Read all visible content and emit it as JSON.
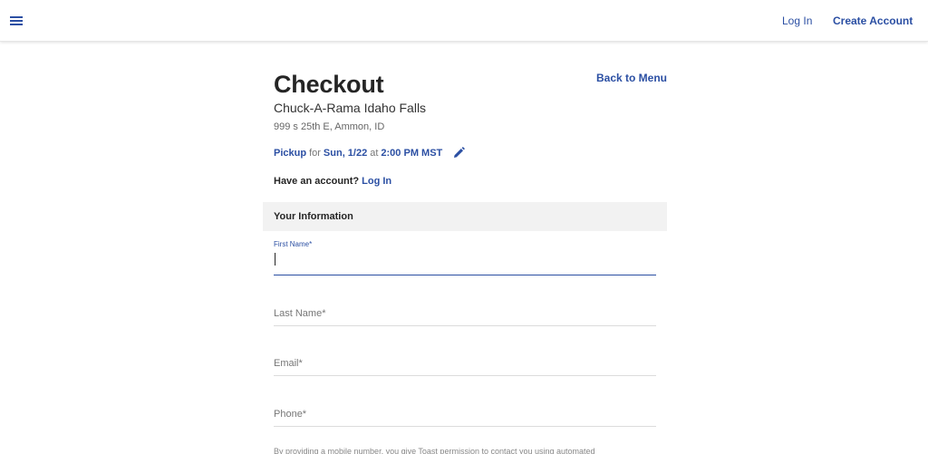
{
  "header": {
    "menu_icon": "hamburger-menu-icon",
    "login_label": "Log In",
    "create_account_label": "Create Account",
    "accent_color": "#2b4fa3"
  },
  "checkout": {
    "title": "Checkout",
    "back_label": "Back to Menu",
    "restaurant_name": "Chuck-A-Rama Idaho Falls",
    "address": "999 s 25th E, Ammon, ID",
    "pickup": {
      "mode": "Pickup",
      "for_word": "for",
      "date": "Sun, 1/22",
      "at_word": "at",
      "time": "2:00 PM MST",
      "edit_icon": "pencil-icon"
    },
    "account_prompt": "Have an account?",
    "account_login": "Log In"
  },
  "form": {
    "section_title": "Your Information",
    "first_name_label": "First Name*",
    "last_name_placeholder": "Last Name*",
    "email_placeholder": "Email*",
    "phone_placeholder": "Phone*",
    "disclaimer": "By providing a mobile number, you give Toast permission to contact you using automated"
  }
}
